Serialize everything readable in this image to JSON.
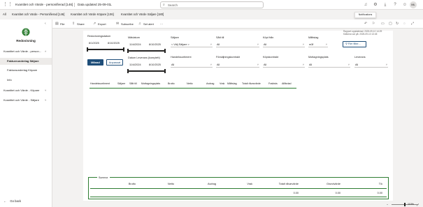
{
  "topbar": {
    "grid_icon": "app-grid-icon",
    "report_title": "Kvantitet och Värde - personifierad [146]",
    "data_updated": "Data updated 25-09-03",
    "search_placeholder": "Search",
    "avatar_initials": "ML"
  },
  "tabs": [
    {
      "label": "All"
    },
    {
      "label": "Kvantitet och Värde - Personifierad [146]"
    },
    {
      "label": "Kvantitet och Värde Köpare [106]"
    },
    {
      "label": "Kvantitet och Värde Säljare [180]"
    }
  ],
  "tooltip": "Notifications",
  "sidebar": {
    "logo_text": "Redovisning",
    "groups": [
      {
        "label": "Kvantitet och Värde - person...",
        "items": [
          "Faktureunderlag Säljare",
          "Fakturaunderlag Köpare",
          "Info"
        ]
      },
      {
        "label": "Kvantitet och Värde - Köpare"
      },
      {
        "label": "Kvantitet och Värde - Säljare"
      }
    ],
    "go_back": "Go back"
  },
  "toolbar": {
    "file": "File",
    "share": "Share",
    "export": "Export",
    "subscribe": "Subscribe",
    "set_alert": "Set alert",
    "more": "···"
  },
  "filters": {
    "redovisningsdatum": {
      "label": "Redovisningsdatum",
      "from": "8/1/2025",
      "to": "8/10/2025"
    },
    "matdatum": {
      "label": "Mätdatum",
      "from": "11/4/2024",
      "to": "8/10/2025"
    },
    "leverans": {
      "label": "Datum Leverans (komplett)",
      "from": "11/4/2024",
      "to": "8/10/2025"
    },
    "saljare": {
      "label": "Säljare",
      "value": "< Välj Säljare >"
    },
    "satt_till": {
      "label": "Sått till",
      "value": "All"
    },
    "kopt_fran": {
      "label": "Köpt från",
      "value": "All"
    },
    "mattslag": {
      "label": "Måttslag",
      "value": "m3f"
    },
    "handelssortiment": {
      "label": "Handelssortiment",
      "value": "All"
    },
    "forsaljningskontrakt": {
      "label": "Försäljningskontrakt",
      "value": "All"
    },
    "kopskontrakt": {
      "label": "Köpskontrakt",
      "value": "All"
    },
    "mottagningsplats": {
      "label": "Mottagningsplats",
      "value": "All"
    },
    "leverans_dd": {
      "label": "Leverans",
      "value": "All"
    },
    "btn_manad": "Månad",
    "btn_anpassat": "Anpassat",
    "more_filters": "Fler filter...",
    "report_updated": "Rapport uppdaterad: 2025-09-10 14:29",
    "sources_updated": "Källorna var på: 2025-09-10 13:45"
  },
  "table_headers": [
    "Handelssortiment",
    "Säljare",
    "Sått till",
    "Mottagningsplats",
    "Brutto",
    "Netto",
    "Avdrag",
    "Vrak",
    "Måttslag",
    "Totalt råvarvärde",
    "Fraktsts",
    "Affärdad"
  ],
  "summary": {
    "title": "Summor",
    "headers": [
      "Brutto",
      "Netto",
      "Avdrag",
      "Vrak",
      "Totalt råvarvärde",
      "Grundvärde",
      "T/k"
    ],
    "values": [
      "",
      "",
      "",
      "",
      "0.00",
      "0.00",
      "0.00"
    ]
  },
  "status": {
    "zoom": "110%"
  }
}
